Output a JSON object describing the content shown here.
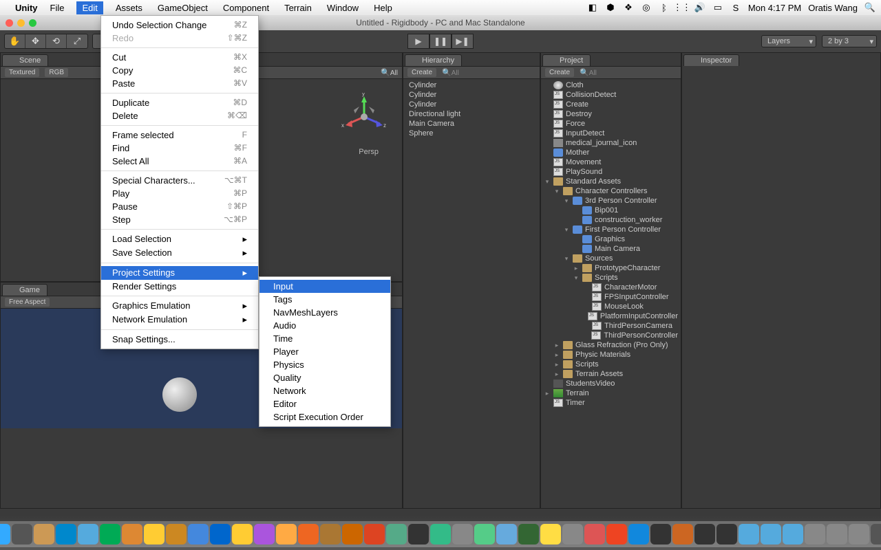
{
  "menubar": {
    "apple": "",
    "app": "Unity",
    "items": [
      "File",
      "Edit",
      "Assets",
      "GameObject",
      "Component",
      "Terrain",
      "Window",
      "Help"
    ],
    "active": "Edit",
    "right": {
      "time": "Mon 4:17 PM",
      "user": "Oratis Wang"
    }
  },
  "window_title": "Untitled - Rigidbody - PC and Mac Standalone",
  "toolbar": {
    "layers": "Layers",
    "layout": "2 by 3"
  },
  "scene": {
    "tab": "Scene",
    "shading": "Textured",
    "render": "RGB",
    "persp": "Persp",
    "axes": {
      "x": "x",
      "y": "y",
      "z": "z"
    }
  },
  "game": {
    "tab": "Game",
    "aspect": "Free Aspect"
  },
  "hierarchy": {
    "tab": "Hierarchy",
    "create": "Create",
    "search_ph": "All",
    "items": [
      "Cylinder",
      "Cylinder",
      "Cylinder",
      "Directional light",
      "Main Camera",
      "Sphere"
    ]
  },
  "project": {
    "tab": "Project",
    "create": "Create",
    "search_ph": "All",
    "items": [
      {
        "indent": 0,
        "arrow": "",
        "icon": "mat",
        "label": "Cloth"
      },
      {
        "indent": 0,
        "arrow": "",
        "icon": "js",
        "label": "CollisionDetect"
      },
      {
        "indent": 0,
        "arrow": "",
        "icon": "js",
        "label": "Create"
      },
      {
        "indent": 0,
        "arrow": "",
        "icon": "js",
        "label": "Destroy"
      },
      {
        "indent": 0,
        "arrow": "",
        "icon": "js",
        "label": "Force"
      },
      {
        "indent": 0,
        "arrow": "",
        "icon": "js",
        "label": "InputDetect"
      },
      {
        "indent": 0,
        "arrow": "",
        "icon": "tex",
        "label": "medical_journal_icon"
      },
      {
        "indent": 0,
        "arrow": "",
        "icon": "prefab",
        "label": "Mother"
      },
      {
        "indent": 0,
        "arrow": "",
        "icon": "js",
        "label": "Movement"
      },
      {
        "indent": 0,
        "arrow": "",
        "icon": "js",
        "label": "PlaySound"
      },
      {
        "indent": 0,
        "arrow": "▾",
        "icon": "folder",
        "label": "Standard Assets"
      },
      {
        "indent": 1,
        "arrow": "▾",
        "icon": "folder",
        "label": "Character Controllers"
      },
      {
        "indent": 2,
        "arrow": "▾",
        "icon": "prefab",
        "label": "3rd Person Controller"
      },
      {
        "indent": 3,
        "arrow": "",
        "icon": "prefab",
        "label": "Bip001"
      },
      {
        "indent": 3,
        "arrow": "",
        "icon": "prefab",
        "label": "construction_worker"
      },
      {
        "indent": 2,
        "arrow": "▾",
        "icon": "prefab",
        "label": "First Person Controller"
      },
      {
        "indent": 3,
        "arrow": "",
        "icon": "prefab",
        "label": "Graphics"
      },
      {
        "indent": 3,
        "arrow": "",
        "icon": "prefab",
        "label": "Main Camera"
      },
      {
        "indent": 2,
        "arrow": "▾",
        "icon": "folder",
        "label": "Sources"
      },
      {
        "indent": 3,
        "arrow": "▸",
        "icon": "folder",
        "label": "PrototypeCharacter"
      },
      {
        "indent": 3,
        "arrow": "▾",
        "icon": "folder",
        "label": "Scripts"
      },
      {
        "indent": 4,
        "arrow": "",
        "icon": "js",
        "label": "CharacterMotor"
      },
      {
        "indent": 4,
        "arrow": "",
        "icon": "js",
        "label": "FPSInputController"
      },
      {
        "indent": 4,
        "arrow": "",
        "icon": "js",
        "label": "MouseLook"
      },
      {
        "indent": 4,
        "arrow": "",
        "icon": "js",
        "label": "PlatformInputController"
      },
      {
        "indent": 4,
        "arrow": "",
        "icon": "js",
        "label": "ThirdPersonCamera"
      },
      {
        "indent": 4,
        "arrow": "",
        "icon": "js",
        "label": "ThirdPersonController"
      },
      {
        "indent": 1,
        "arrow": "▸",
        "icon": "folder",
        "label": "Glass Refraction (Pro Only)"
      },
      {
        "indent": 1,
        "arrow": "▸",
        "icon": "folder",
        "label": "Physic Materials"
      },
      {
        "indent": 1,
        "arrow": "▸",
        "icon": "folder",
        "label": "Scripts"
      },
      {
        "indent": 1,
        "arrow": "▸",
        "icon": "folder",
        "label": "Terrain Assets"
      },
      {
        "indent": 0,
        "arrow": "",
        "icon": "video",
        "label": "StudentsVideo"
      },
      {
        "indent": 0,
        "arrow": "▸",
        "icon": "terrain",
        "label": "Terrain"
      },
      {
        "indent": 0,
        "arrow": "",
        "icon": "js",
        "label": "Timer"
      }
    ]
  },
  "inspector": {
    "tab": "Inspector"
  },
  "edit_menu": [
    {
      "label": "Undo Selection Change",
      "sc": "⌘Z"
    },
    {
      "label": "Redo",
      "sc": "⇧⌘Z",
      "disabled": true
    },
    {
      "sep": true
    },
    {
      "label": "Cut",
      "sc": "⌘X"
    },
    {
      "label": "Copy",
      "sc": "⌘C"
    },
    {
      "label": "Paste",
      "sc": "⌘V"
    },
    {
      "sep": true
    },
    {
      "label": "Duplicate",
      "sc": "⌘D"
    },
    {
      "label": "Delete",
      "sc": "⌘⌫"
    },
    {
      "sep": true
    },
    {
      "label": "Frame selected",
      "sc": "F"
    },
    {
      "label": "Find",
      "sc": "⌘F"
    },
    {
      "label": "Select All",
      "sc": "⌘A"
    },
    {
      "sep": true
    },
    {
      "label": "Special Characters...",
      "sc": "⌥⌘T"
    },
    {
      "label": "Play",
      "sc": "⌘P"
    },
    {
      "label": "Pause",
      "sc": "⇧⌘P"
    },
    {
      "label": "Step",
      "sc": "⌥⌘P"
    },
    {
      "sep": true
    },
    {
      "label": "Load Selection",
      "sub": true
    },
    {
      "label": "Save Selection",
      "sub": true
    },
    {
      "sep": true
    },
    {
      "label": "Project Settings",
      "sub": true,
      "highlight": true
    },
    {
      "label": "Render Settings"
    },
    {
      "sep": true
    },
    {
      "label": "Graphics Emulation",
      "sub": true
    },
    {
      "label": "Network Emulation",
      "sub": true
    },
    {
      "sep": true
    },
    {
      "label": "Snap Settings..."
    }
  ],
  "submenu": [
    {
      "label": "Input",
      "highlight": true
    },
    {
      "label": "Tags"
    },
    {
      "label": "NavMeshLayers"
    },
    {
      "label": "Audio"
    },
    {
      "label": "Time"
    },
    {
      "label": "Player"
    },
    {
      "label": "Physics"
    },
    {
      "label": "Quality"
    },
    {
      "label": "Network"
    },
    {
      "label": "Editor"
    },
    {
      "label": "Script Execution Order"
    }
  ]
}
